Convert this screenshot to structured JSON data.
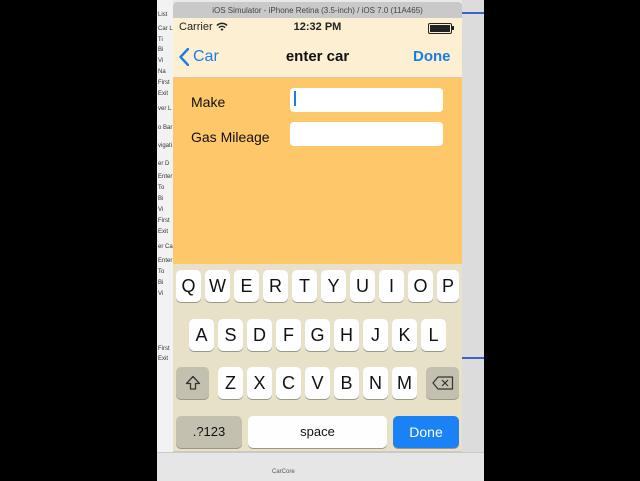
{
  "simulator": {
    "title": "iOS Simulator - iPhone Retina (3.5-inch) / iOS 7.0 (11A465)"
  },
  "status_bar": {
    "carrier": "Carrier",
    "time": "12:32 PM"
  },
  "nav": {
    "back_label": "Car",
    "title": "enter car",
    "done_label": "Done"
  },
  "form": {
    "make_label": "Make",
    "mileage_label": "Gas Mileage",
    "make_value": "",
    "mileage_value": ""
  },
  "keyboard": {
    "row1": [
      "Q",
      "W",
      "E",
      "R",
      "T",
      "Y",
      "U",
      "I",
      "O",
      "P"
    ],
    "row2": [
      "A",
      "S",
      "D",
      "F",
      "G",
      "H",
      "J",
      "K",
      "L"
    ],
    "row3": [
      "Z",
      "X",
      "C",
      "V",
      "B",
      "N",
      "M"
    ],
    "numbers_label": ".?123",
    "space_label": "space",
    "done_label": "Done"
  },
  "xcode": {
    "left_labels": [
      "List",
      "Car L",
      "Ti",
      "Bi",
      "Vi",
      "Na",
      "First",
      "Exit",
      "ver L",
      "o Bar",
      "vigati",
      "er D",
      "Enter",
      "To",
      "Bi",
      "Vi",
      "First",
      "Exit",
      "er Ca",
      "Enter",
      "To",
      "Bi",
      "Vi",
      "First",
      "Exit"
    ],
    "bottom_label": "CarCore"
  },
  "colors": {
    "accent": "#1a7ee6",
    "content_bg": "#fec76a",
    "nav_bg": "#fdf0d2",
    "keyboard_bg": "#e7e1c8"
  }
}
